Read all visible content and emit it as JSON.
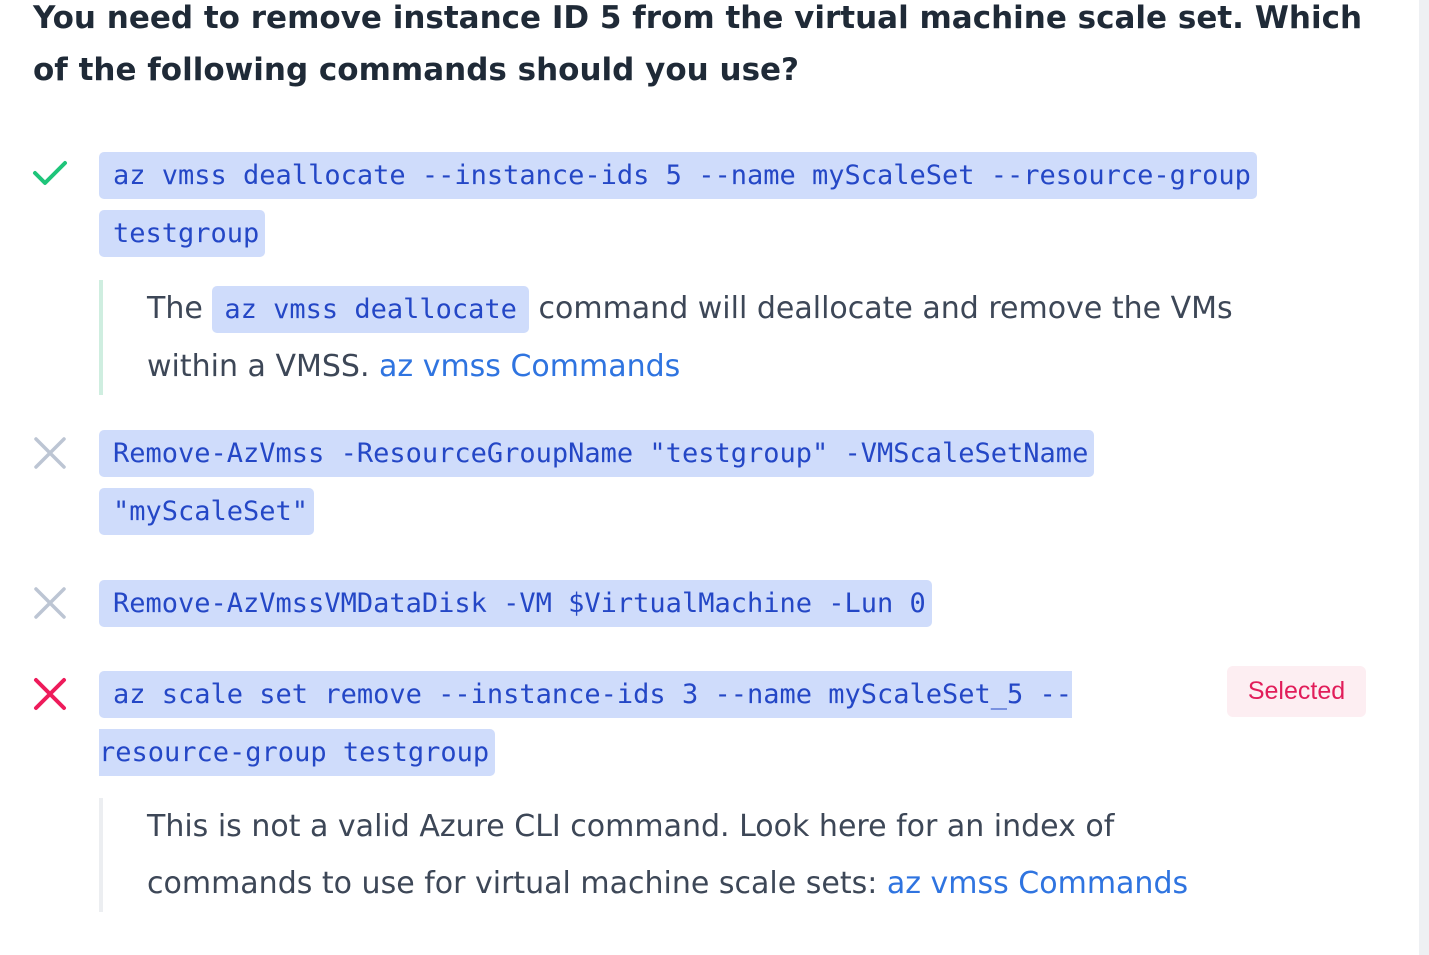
{
  "question": {
    "text": "You need to remove instance ID 5 from the virtual machine scale set. Which of the following commands should you use?"
  },
  "options": [
    {
      "status": "correct",
      "status_icon": "check-icon",
      "command": "az vmss deallocate --instance-ids 5 --name myScaleSet --resource-group testgroup",
      "explanation": {
        "before": "The",
        "code": "az vmss deallocate",
        "after": "command will deallocate and remove the VMs within a VMSS.",
        "link": "az vmss Commands"
      }
    },
    {
      "status": "incorrect",
      "status_icon": "x-icon",
      "command": "Remove-AzVmss -ResourceGroupName \"testgroup\" -VMScaleSetName \"myScaleSet\""
    },
    {
      "status": "incorrect",
      "status_icon": "x-icon",
      "command": "Remove-AzVmssVMDataDisk -VM $VirtualMachine -Lun 0"
    },
    {
      "status": "selected-incorrect",
      "status_icon": "x-icon",
      "command": "az scale set remove --instance-ids 3 --name myScaleSet_5 --resource-group testgroup",
      "badge": "Selected",
      "explanation": {
        "text": "This is not a valid Azure CLI command. Look here for an index of commands to use for virtual machine scale sets:",
        "link": "az vmss Commands"
      }
    }
  ],
  "colors": {
    "correct": "#1ec57a",
    "incorrect": "#bcc5d3",
    "selected_incorrect": "#ee1b5b",
    "code_bg": "#cfdcfb",
    "code_text": "#2447c6",
    "link": "#2f74e0"
  }
}
